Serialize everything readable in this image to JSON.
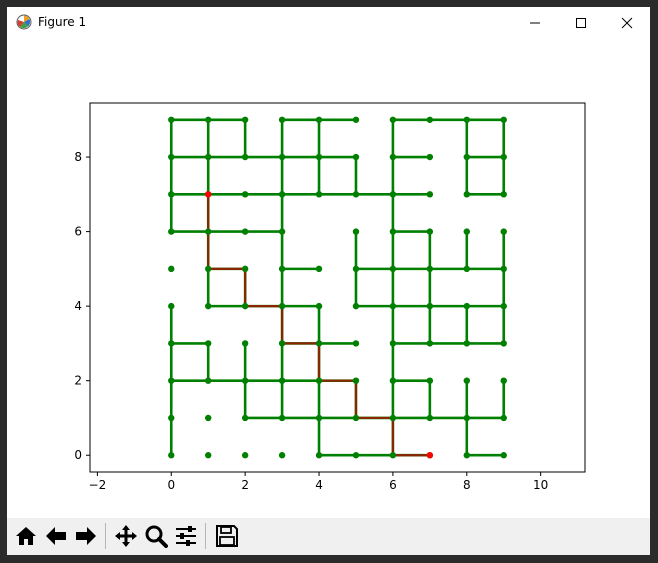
{
  "window": {
    "title": "Figure 1",
    "app_icon": "matplotlib-logo-icon",
    "controls": [
      "minimize-icon",
      "maximize-icon",
      "close-icon"
    ]
  },
  "toolbar": {
    "buttons": [
      "home-icon",
      "back-arrow-icon",
      "forward-arrow-icon",
      "pan-move-icon",
      "zoom-magnifier-icon",
      "configure-subplots-icon",
      "save-floppy-icon"
    ]
  },
  "colors": {
    "grid_edge": "#008000",
    "path_edge": "#8b2500",
    "node": "#008000",
    "endpoint_node": "#ff0000"
  },
  "chart_data": {
    "type": "scatter",
    "title": "",
    "xlabel": "",
    "ylabel": "",
    "xlim": [
      -2.2,
      11.2
    ],
    "ylim": [
      -0.45,
      9.45
    ],
    "xticks": [
      -2,
      0,
      2,
      4,
      6,
      8,
      10
    ],
    "yticks": [
      0,
      2,
      4,
      6,
      8
    ],
    "grid": false,
    "nodes": [
      [
        0,
        0
      ],
      [
        1,
        0
      ],
      [
        2,
        0
      ],
      [
        3,
        0
      ],
      [
        4,
        0
      ],
      [
        5,
        0
      ],
      [
        6,
        0
      ],
      [
        7,
        0
      ],
      [
        8,
        0
      ],
      [
        9,
        0
      ],
      [
        0,
        1
      ],
      [
        1,
        1
      ],
      [
        2,
        1
      ],
      [
        3,
        1
      ],
      [
        4,
        1
      ],
      [
        5,
        1
      ],
      [
        6,
        1
      ],
      [
        7,
        1
      ],
      [
        8,
        1
      ],
      [
        9,
        1
      ],
      [
        0,
        2
      ],
      [
        1,
        2
      ],
      [
        2,
        2
      ],
      [
        3,
        2
      ],
      [
        4,
        2
      ],
      [
        5,
        2
      ],
      [
        6,
        2
      ],
      [
        7,
        2
      ],
      [
        8,
        2
      ],
      [
        9,
        2
      ],
      [
        0,
        3
      ],
      [
        1,
        3
      ],
      [
        2,
        3
      ],
      [
        3,
        3
      ],
      [
        4,
        3
      ],
      [
        5,
        3
      ],
      [
        6,
        3
      ],
      [
        7,
        3
      ],
      [
        8,
        3
      ],
      [
        9,
        3
      ],
      [
        0,
        4
      ],
      [
        1,
        4
      ],
      [
        2,
        4
      ],
      [
        3,
        4
      ],
      [
        4,
        4
      ],
      [
        5,
        4
      ],
      [
        6,
        4
      ],
      [
        7,
        4
      ],
      [
        8,
        4
      ],
      [
        9,
        4
      ],
      [
        0,
        5
      ],
      [
        1,
        5
      ],
      [
        2,
        5
      ],
      [
        3,
        5
      ],
      [
        4,
        5
      ],
      [
        5,
        5
      ],
      [
        6,
        5
      ],
      [
        7,
        5
      ],
      [
        8,
        5
      ],
      [
        9,
        5
      ],
      [
        0,
        6
      ],
      [
        1,
        6
      ],
      [
        2,
        6
      ],
      [
        3,
        6
      ],
      [
        5,
        6
      ],
      [
        6,
        6
      ],
      [
        7,
        6
      ],
      [
        8,
        6
      ],
      [
        9,
        6
      ],
      [
        0,
        7
      ],
      [
        1,
        7
      ],
      [
        2,
        7
      ],
      [
        3,
        7
      ],
      [
        4,
        7
      ],
      [
        5,
        7
      ],
      [
        6,
        7
      ],
      [
        7,
        7
      ],
      [
        8,
        7
      ],
      [
        9,
        7
      ],
      [
        0,
        8
      ],
      [
        1,
        8
      ],
      [
        2,
        8
      ],
      [
        3,
        8
      ],
      [
        4,
        8
      ],
      [
        5,
        8
      ],
      [
        6,
        8
      ],
      [
        7,
        8
      ],
      [
        8,
        8
      ],
      [
        9,
        8
      ],
      [
        0,
        9
      ],
      [
        1,
        9
      ],
      [
        2,
        9
      ],
      [
        3,
        9
      ],
      [
        4,
        9
      ],
      [
        5,
        9
      ],
      [
        6,
        9
      ],
      [
        7,
        9
      ],
      [
        8,
        9
      ],
      [
        9,
        9
      ]
    ],
    "endpoints": [
      [
        1,
        7
      ],
      [
        7,
        0
      ]
    ],
    "edges": [
      [
        [
          0,
          9
        ],
        [
          1,
          9
        ]
      ],
      [
        [
          1,
          9
        ],
        [
          2,
          9
        ]
      ],
      [
        [
          3,
          9
        ],
        [
          4,
          9
        ]
      ],
      [
        [
          4,
          9
        ],
        [
          5,
          9
        ]
      ],
      [
        [
          6,
          9
        ],
        [
          7,
          9
        ]
      ],
      [
        [
          7,
          9
        ],
        [
          8,
          9
        ]
      ],
      [
        [
          8,
          9
        ],
        [
          9,
          9
        ]
      ],
      [
        [
          0,
          8
        ],
        [
          1,
          8
        ]
      ],
      [
        [
          1,
          8
        ],
        [
          2,
          8
        ]
      ],
      [
        [
          2,
          8
        ],
        [
          3,
          8
        ]
      ],
      [
        [
          3,
          8
        ],
        [
          4,
          8
        ]
      ],
      [
        [
          4,
          8
        ],
        [
          5,
          8
        ]
      ],
      [
        [
          6,
          8
        ],
        [
          7,
          8
        ]
      ],
      [
        [
          8,
          8
        ],
        [
          9,
          8
        ]
      ],
      [
        [
          0,
          7
        ],
        [
          1,
          7
        ]
      ],
      [
        [
          1,
          7
        ],
        [
          2,
          7
        ]
      ],
      [
        [
          2,
          7
        ],
        [
          3,
          7
        ]
      ],
      [
        [
          3,
          7
        ],
        [
          4,
          7
        ]
      ],
      [
        [
          4,
          7
        ],
        [
          5,
          7
        ]
      ],
      [
        [
          5,
          7
        ],
        [
          6,
          7
        ]
      ],
      [
        [
          6,
          7
        ],
        [
          7,
          7
        ]
      ],
      [
        [
          8,
          7
        ],
        [
          9,
          7
        ]
      ],
      [
        [
          0,
          6
        ],
        [
          1,
          6
        ]
      ],
      [
        [
          1,
          6
        ],
        [
          2,
          6
        ]
      ],
      [
        [
          2,
          6
        ],
        [
          3,
          6
        ]
      ],
      [
        [
          6,
          6
        ],
        [
          7,
          6
        ]
      ],
      [
        [
          1,
          5
        ],
        [
          2,
          5
        ]
      ],
      [
        [
          3,
          5
        ],
        [
          4,
          5
        ]
      ],
      [
        [
          5,
          5
        ],
        [
          6,
          5
        ]
      ],
      [
        [
          6,
          5
        ],
        [
          7,
          5
        ]
      ],
      [
        [
          7,
          5
        ],
        [
          8,
          5
        ]
      ],
      [
        [
          8,
          5
        ],
        [
          9,
          5
        ]
      ],
      [
        [
          1,
          4
        ],
        [
          2,
          4
        ]
      ],
      [
        [
          2,
          4
        ],
        [
          3,
          4
        ]
      ],
      [
        [
          3,
          4
        ],
        [
          4,
          4
        ]
      ],
      [
        [
          5,
          4
        ],
        [
          6,
          4
        ]
      ],
      [
        [
          6,
          4
        ],
        [
          7,
          4
        ]
      ],
      [
        [
          7,
          4
        ],
        [
          8,
          4
        ]
      ],
      [
        [
          8,
          4
        ],
        [
          9,
          4
        ]
      ],
      [
        [
          0,
          3
        ],
        [
          1,
          3
        ]
      ],
      [
        [
          3,
          3
        ],
        [
          4,
          3
        ]
      ],
      [
        [
          4,
          3
        ],
        [
          5,
          3
        ]
      ],
      [
        [
          6,
          3
        ],
        [
          7,
          3
        ]
      ],
      [
        [
          7,
          3
        ],
        [
          8,
          3
        ]
      ],
      [
        [
          8,
          3
        ],
        [
          9,
          3
        ]
      ],
      [
        [
          0,
          2
        ],
        [
          1,
          2
        ]
      ],
      [
        [
          1,
          2
        ],
        [
          2,
          2
        ]
      ],
      [
        [
          2,
          2
        ],
        [
          3,
          2
        ]
      ],
      [
        [
          3,
          2
        ],
        [
          4,
          2
        ]
      ],
      [
        [
          4,
          2
        ],
        [
          5,
          2
        ]
      ],
      [
        [
          6,
          2
        ],
        [
          7,
          2
        ]
      ],
      [
        [
          2,
          1
        ],
        [
          3,
          1
        ]
      ],
      [
        [
          3,
          1
        ],
        [
          4,
          1
        ]
      ],
      [
        [
          4,
          1
        ],
        [
          5,
          1
        ]
      ],
      [
        [
          5,
          1
        ],
        [
          6,
          1
        ]
      ],
      [
        [
          6,
          1
        ],
        [
          7,
          1
        ]
      ],
      [
        [
          7,
          1
        ],
        [
          8,
          1
        ]
      ],
      [
        [
          8,
          1
        ],
        [
          9,
          1
        ]
      ],
      [
        [
          4,
          0
        ],
        [
          5,
          0
        ]
      ],
      [
        [
          5,
          0
        ],
        [
          6,
          0
        ]
      ],
      [
        [
          6,
          0
        ],
        [
          7,
          0
        ]
      ],
      [
        [
          8,
          0
        ],
        [
          9,
          0
        ]
      ],
      [
        [
          0,
          9
        ],
        [
          0,
          8
        ]
      ],
      [
        [
          0,
          8
        ],
        [
          0,
          7
        ]
      ],
      [
        [
          0,
          7
        ],
        [
          0,
          6
        ]
      ],
      [
        [
          0,
          4
        ],
        [
          0,
          3
        ]
      ],
      [
        [
          0,
          3
        ],
        [
          0,
          2
        ]
      ],
      [
        [
          0,
          2
        ],
        [
          0,
          1
        ]
      ],
      [
        [
          0,
          1
        ],
        [
          0,
          0
        ]
      ],
      [
        [
          1,
          9
        ],
        [
          1,
          8
        ]
      ],
      [
        [
          1,
          8
        ],
        [
          1,
          7
        ]
      ],
      [
        [
          1,
          7
        ],
        [
          1,
          6
        ]
      ],
      [
        [
          1,
          6
        ],
        [
          1,
          5
        ]
      ],
      [
        [
          1,
          5
        ],
        [
          1,
          4
        ]
      ],
      [
        [
          1,
          3
        ],
        [
          1,
          2
        ]
      ],
      [
        [
          2,
          9
        ],
        [
          2,
          8
        ]
      ],
      [
        [
          2,
          5
        ],
        [
          2,
          4
        ]
      ],
      [
        [
          2,
          3
        ],
        [
          2,
          2
        ]
      ],
      [
        [
          2,
          2
        ],
        [
          2,
          1
        ]
      ],
      [
        [
          3,
          9
        ],
        [
          3,
          8
        ]
      ],
      [
        [
          3,
          8
        ],
        [
          3,
          7
        ]
      ],
      [
        [
          3,
          7
        ],
        [
          3,
          6
        ]
      ],
      [
        [
          3,
          6
        ],
        [
          3,
          5
        ]
      ],
      [
        [
          3,
          5
        ],
        [
          3,
          4
        ]
      ],
      [
        [
          3,
          4
        ],
        [
          3,
          3
        ]
      ],
      [
        [
          3,
          3
        ],
        [
          3,
          2
        ]
      ],
      [
        [
          3,
          2
        ],
        [
          3,
          1
        ]
      ],
      [
        [
          4,
          9
        ],
        [
          4,
          8
        ]
      ],
      [
        [
          4,
          8
        ],
        [
          4,
          7
        ]
      ],
      [
        [
          4,
          4
        ],
        [
          4,
          3
        ]
      ],
      [
        [
          4,
          3
        ],
        [
          4,
          2
        ]
      ],
      [
        [
          4,
          2
        ],
        [
          4,
          1
        ]
      ],
      [
        [
          4,
          1
        ],
        [
          4,
          0
        ]
      ],
      [
        [
          5,
          8
        ],
        [
          5,
          7
        ]
      ],
      [
        [
          5,
          6
        ],
        [
          5,
          5
        ]
      ],
      [
        [
          5,
          5
        ],
        [
          5,
          4
        ]
      ],
      [
        [
          5,
          2
        ],
        [
          5,
          1
        ]
      ],
      [
        [
          6,
          9
        ],
        [
          6,
          8
        ]
      ],
      [
        [
          6,
          8
        ],
        [
          6,
          7
        ]
      ],
      [
        [
          6,
          7
        ],
        [
          6,
          6
        ]
      ],
      [
        [
          6,
          6
        ],
        [
          6,
          5
        ]
      ],
      [
        [
          6,
          5
        ],
        [
          6,
          4
        ]
      ],
      [
        [
          6,
          4
        ],
        [
          6,
          3
        ]
      ],
      [
        [
          6,
          3
        ],
        [
          6,
          2
        ]
      ],
      [
        [
          6,
          2
        ],
        [
          6,
          1
        ]
      ],
      [
        [
          6,
          1
        ],
        [
          6,
          0
        ]
      ],
      [
        [
          7,
          6
        ],
        [
          7,
          5
        ]
      ],
      [
        [
          7,
          5
        ],
        [
          7,
          4
        ]
      ],
      [
        [
          7,
          4
        ],
        [
          7,
          3
        ]
      ],
      [
        [
          7,
          2
        ],
        [
          7,
          1
        ]
      ],
      [
        [
          8,
          9
        ],
        [
          8,
          8
        ]
      ],
      [
        [
          8,
          8
        ],
        [
          8,
          7
        ]
      ],
      [
        [
          8,
          6
        ],
        [
          8,
          5
        ]
      ],
      [
        [
          8,
          4
        ],
        [
          8,
          3
        ]
      ],
      [
        [
          8,
          2
        ],
        [
          8,
          1
        ]
      ],
      [
        [
          8,
          1
        ],
        [
          8,
          0
        ]
      ],
      [
        [
          9,
          9
        ],
        [
          9,
          8
        ]
      ],
      [
        [
          9,
          8
        ],
        [
          9,
          7
        ]
      ],
      [
        [
          9,
          6
        ],
        [
          9,
          5
        ]
      ],
      [
        [
          9,
          5
        ],
        [
          9,
          4
        ]
      ],
      [
        [
          9,
          4
        ],
        [
          9,
          3
        ]
      ],
      [
        [
          9,
          2
        ],
        [
          9,
          1
        ]
      ]
    ],
    "path": [
      [
        1,
        7
      ],
      [
        1,
        6
      ],
      [
        1,
        5
      ],
      [
        2,
        5
      ],
      [
        2,
        4
      ],
      [
        3,
        4
      ],
      [
        3,
        3
      ],
      [
        4,
        3
      ],
      [
        4,
        2
      ],
      [
        5,
        2
      ],
      [
        5,
        1
      ],
      [
        6,
        1
      ],
      [
        6,
        0
      ],
      [
        7,
        0
      ]
    ]
  }
}
